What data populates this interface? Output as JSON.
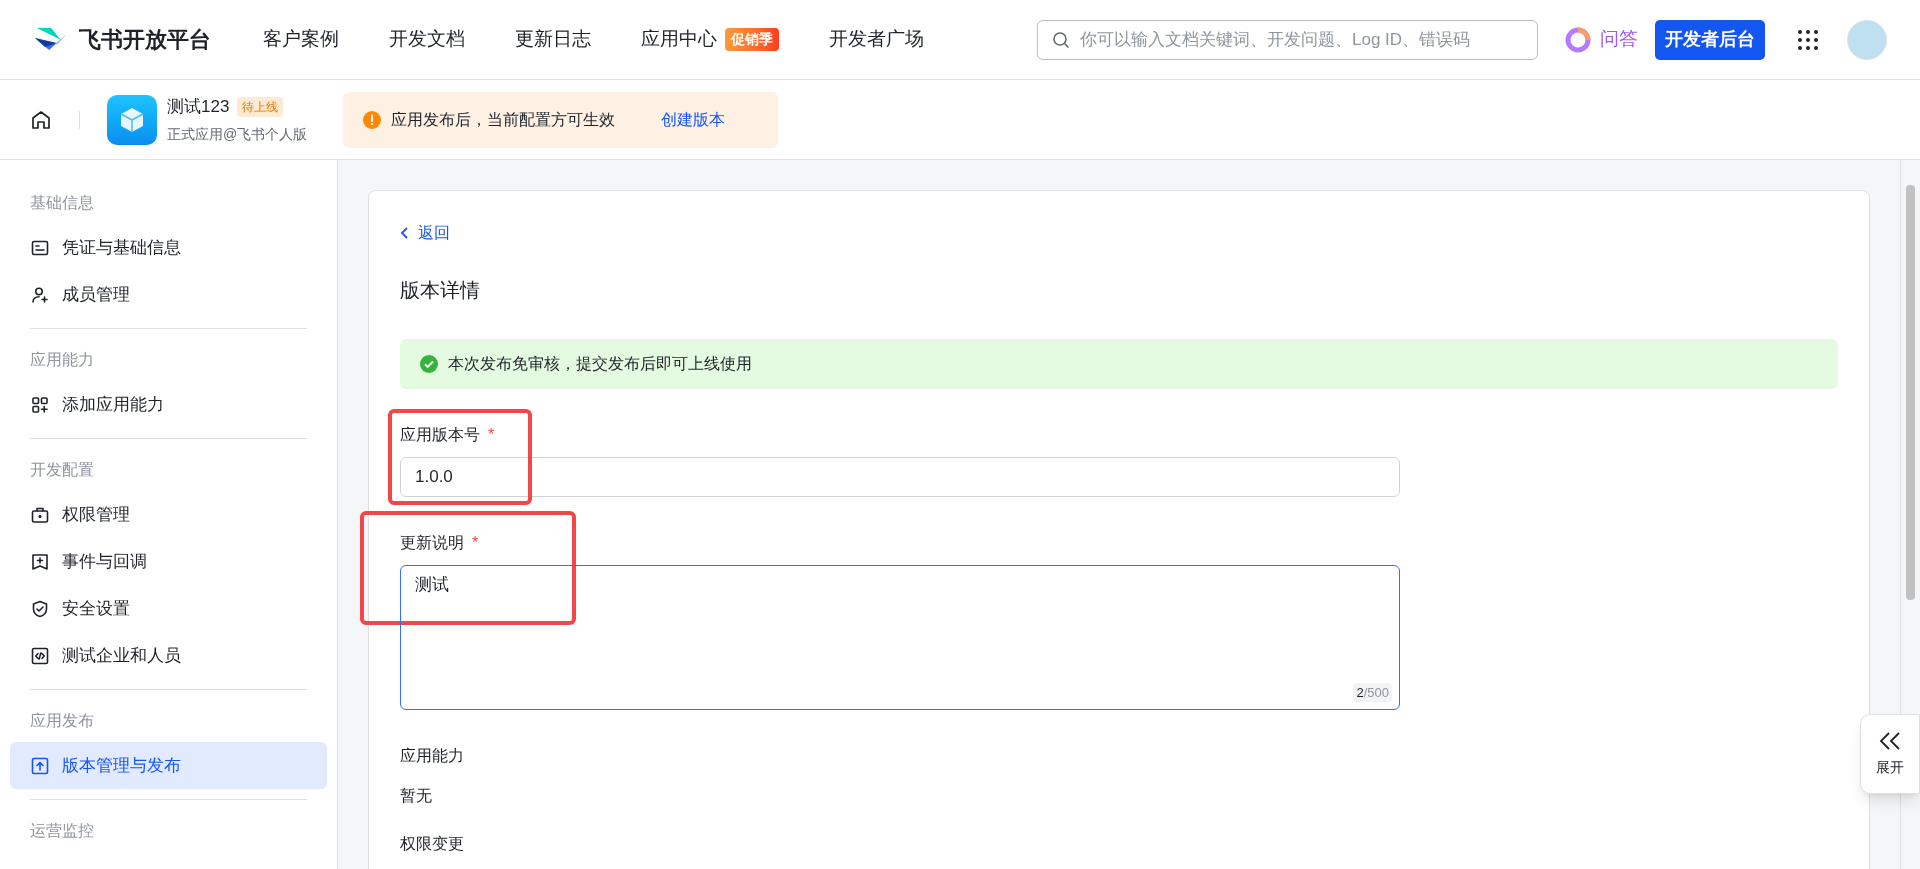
{
  "header": {
    "logo_text": "飞书开放平台",
    "nav": [
      {
        "label": "客户案例"
      },
      {
        "label": "开发文档"
      },
      {
        "label": "更新日志"
      },
      {
        "label": "应用中心",
        "badge": "促销季"
      },
      {
        "label": "开发者广场"
      }
    ],
    "search": {
      "placeholder": "你可以输入文档关键词、开发问题、Log ID、错误码"
    },
    "ask": "问答",
    "console_button": "开发者后台"
  },
  "app_bar": {
    "app_name": "测试123",
    "status": "待上线",
    "subtitle": "正式应用@飞书个人版",
    "notice": "应用发布后，当前配置方可生效",
    "notice_link": "创建版本"
  },
  "sidebar": {
    "sections": [
      {
        "title": "基础信息",
        "items": [
          {
            "label": "凭证与基础信息",
            "kind": "card",
            "selected": false
          },
          {
            "label": "成员管理",
            "kind": "user-plus",
            "selected": false
          }
        ]
      },
      {
        "title": "应用能力",
        "items": [
          {
            "label": "添加应用能力",
            "kind": "grid-plus",
            "selected": false
          }
        ]
      },
      {
        "title": "开发配置",
        "items": [
          {
            "label": "权限管理",
            "kind": "lock",
            "selected": false
          },
          {
            "label": "事件与回调",
            "kind": "plus-flag",
            "selected": false
          },
          {
            "label": "安全设置",
            "kind": "shield",
            "selected": false
          },
          {
            "label": "测试企业和人员",
            "kind": "code",
            "selected": false
          }
        ]
      },
      {
        "title": "应用发布",
        "items": [
          {
            "label": "版本管理与发布",
            "kind": "upload",
            "selected": true
          }
        ]
      },
      {
        "title": "运营监控"
      }
    ]
  },
  "content": {
    "back": "返回",
    "title": "版本详情",
    "success": "本次发布免审核，提交发布后即可上线使用",
    "fields": [
      {
        "kind": "input",
        "label": "应用版本号",
        "required_mark": "*",
        "value": "1.0.0",
        "highlighted": true,
        "focused": false
      },
      {
        "kind": "textarea",
        "label": "更新说明",
        "required_mark": "*",
        "value": "测试",
        "counter_used": "2",
        "counter_max": "/500",
        "highlighted": true,
        "focused": true
      }
    ],
    "sections": [
      {
        "title": "应用能力",
        "value": "暂无"
      },
      {
        "title": "权限变更"
      }
    ]
  },
  "expand_button": "展开"
}
